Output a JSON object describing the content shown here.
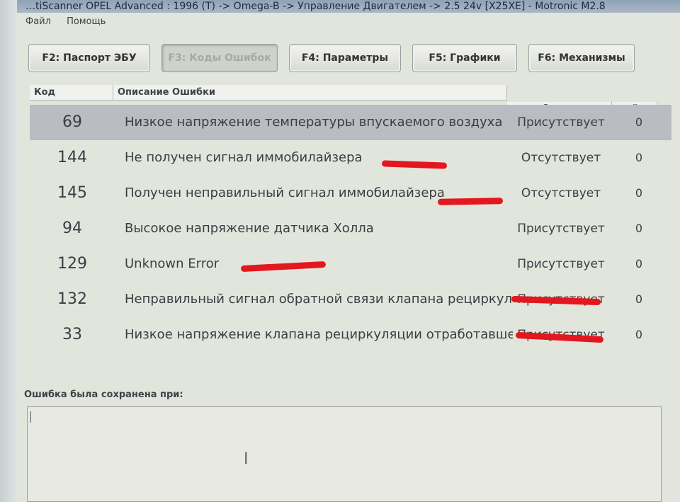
{
  "window": {
    "title": "…tiScanner OPEL Advanced : 1996 (T) -> Omega-B -> Управление Двигателем -> 2.5 24v [X25XE] - Motronic M2.8"
  },
  "menu": [
    "Файл",
    "Помощь"
  ],
  "tabs": [
    {
      "label": "F2: Паспорт ЭБУ"
    },
    {
      "label": "F3: Коды Ошибок"
    },
    {
      "label": "F4: Параметры"
    },
    {
      "label": "F5: Графики"
    },
    {
      "label": "F6: Механизмы"
    }
  ],
  "table": {
    "columns": {
      "code": "Код",
      "description": "Описание Ошибки",
      "status": "Статус",
      "count": "#"
    },
    "rows": [
      {
        "code": "69",
        "description": "Низкое напряжение температуры впускаемого воздуха",
        "status": "Присутствует",
        "count": "0"
      },
      {
        "code": "144",
        "description": "Не получен сигнал иммобилайзера",
        "status": "Отсутствует",
        "count": "0"
      },
      {
        "code": "145",
        "description": "Получен неправильный сигнал иммобилайзера",
        "status": "Отсутствует",
        "count": "0"
      },
      {
        "code": "94",
        "description": "Высокое напряжение датчика Холла",
        "status": "Присутствует",
        "count": "0"
      },
      {
        "code": "129",
        "description": "Unknown Error",
        "status": "Присутствует",
        "count": "0"
      },
      {
        "code": "132",
        "description": "Неправильный сигнал обратной связи клапана рециркуля",
        "status": "Присутствует",
        "count": "0"
      },
      {
        "code": "33",
        "description": "Низкое напряжение клапана рециркуляции отработавше",
        "status": "Присутствует",
        "count": "0"
      }
    ]
  },
  "saved": {
    "label": "Ошибка была сохранена при:",
    "value": ""
  },
  "colors": {
    "selected_row": "#b9bcc3",
    "redaction": "#e3171e"
  }
}
